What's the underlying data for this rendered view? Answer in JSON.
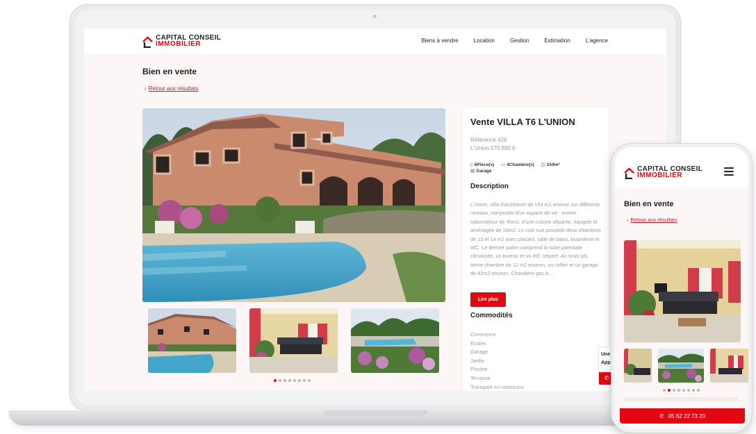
{
  "brand": {
    "line1": "CAPITAL CONSEIL",
    "line2": "IMMOBILIER",
    "accent_color": "#e30613",
    "icon": "house-roof-logo-icon"
  },
  "nav": {
    "items": [
      "Biens à vendre",
      "Location",
      "Gestion",
      "Estimation",
      "L'agence"
    ]
  },
  "page": {
    "title": "Bien en vente",
    "back_label": "Retour aux résultats"
  },
  "property": {
    "title": "Vente VILLA T6 L'UNION",
    "reference": "Référence 426",
    "location_price": "L'Union  579 890 €",
    "features": [
      {
        "icon": "door-icon",
        "label": "6Pièce(s)"
      },
      {
        "icon": "bed-icon",
        "label": "4Chambre(s)"
      },
      {
        "icon": "area-icon",
        "label": "154m²"
      },
      {
        "icon": "garage-icon",
        "label": "Garage"
      }
    ],
    "description_heading": "Description",
    "description": "L'Union, villa d'architecte de 154 m2 environ sur différents niveaux, composée d'un espace de vie : entrée salon/séjour de 45m2, d'une cuisine séparée, équipée et aménagée de 16m2. Le coin nuit possède deux chambres de 13 et 14 m2 avec placard, salle de bains, buanderie et WC. Le dernier palier comprend la suite parentale climatisée, un bureau et un WC séparé. Au sous sol, 4ème chambre de 12 m2 environ, un cellier et un garage de 42m2 environ. Chaudière gaz à....",
    "read_more_label": "Lire plus",
    "amenities_heading": "Commodités",
    "amenities": [
      "Commerce",
      "Ecoles",
      "Garage",
      "Jardin",
      "Piscine",
      "Terrasse",
      "Transport en communs"
    ]
  },
  "carousel": {
    "thumbnails": [
      "villa-pool-photo",
      "living-room-photo",
      "garden-flowers-photo"
    ],
    "dot_count": 8,
    "active_dot": 0
  },
  "side_widget": {
    "line1": "Une",
    "line2": "App",
    "icon": "phone-icon"
  },
  "mobile": {
    "title": "Bien en vente",
    "back_label": "Retour aux résultats",
    "dot_count": 8,
    "active_dot": 1,
    "phone_number": "05 62 22 73 20"
  }
}
